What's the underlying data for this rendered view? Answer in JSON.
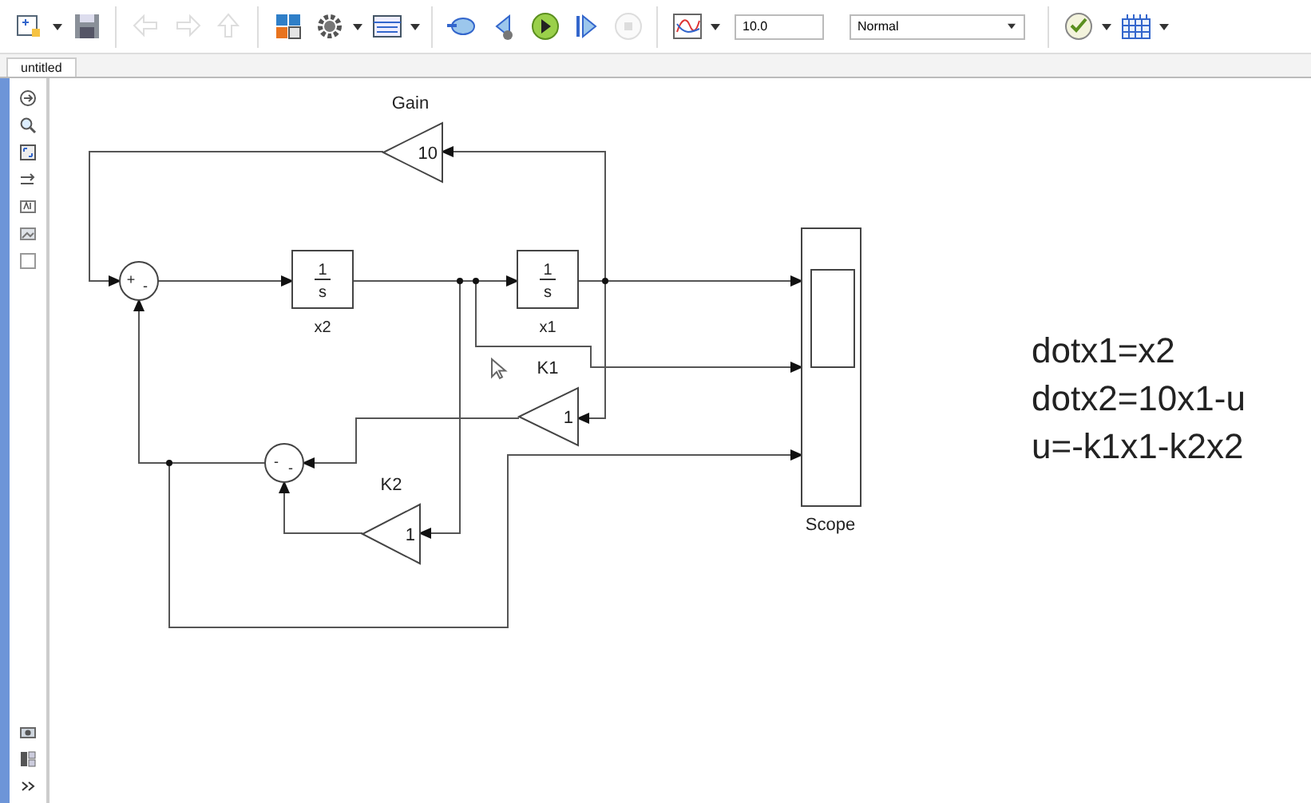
{
  "toolbar": {
    "buttons": [
      {
        "kind": "new",
        "disabled": false
      },
      {
        "kind": "save",
        "disabled": false
      },
      {
        "kind": "back",
        "disabled": true
      },
      {
        "kind": "forward",
        "disabled": true
      },
      {
        "kind": "up",
        "disabled": true
      },
      {
        "kind": "library",
        "disabled": false
      },
      {
        "kind": "settings",
        "disabled": false
      },
      {
        "kind": "explorer",
        "disabled": false
      },
      {
        "kind": "update",
        "disabled": false
      },
      {
        "kind": "step-back",
        "disabled": false
      },
      {
        "kind": "run",
        "disabled": false
      },
      {
        "kind": "step-forward",
        "disabled": false
      },
      {
        "kind": "stop",
        "disabled": true
      },
      {
        "kind": "inspector",
        "disabled": false
      }
    ],
    "stop_time": "10.0",
    "sim_mode": "Normal",
    "tail_buttons": [
      {
        "kind": "check",
        "disabled": false
      },
      {
        "kind": "grid",
        "disabled": false
      }
    ]
  },
  "tabs": [
    {
      "label": "untitled",
      "selected": true
    }
  ],
  "diagram": {
    "blocks": [
      {
        "kind": "gain",
        "name": "Gain",
        "value": "10"
      },
      {
        "kind": "sum",
        "signs": [
          "+",
          "-"
        ]
      },
      {
        "kind": "integrator",
        "name": "x2",
        "numerator": "1",
        "denominator": "s"
      },
      {
        "kind": "integrator",
        "name": "x1",
        "numerator": "1",
        "denominator": "s"
      },
      {
        "kind": "gain",
        "name": "K1",
        "value": "1"
      },
      {
        "kind": "sum",
        "signs": [
          "-",
          "-"
        ]
      },
      {
        "kind": "gain",
        "name": "K2",
        "value": "1"
      },
      {
        "kind": "scope",
        "name": "Scope"
      }
    ]
  },
  "equations": [
    "dotx1=x2",
    "dotx2=10x1-u",
    "u=-k1x1-k2x2"
  ]
}
